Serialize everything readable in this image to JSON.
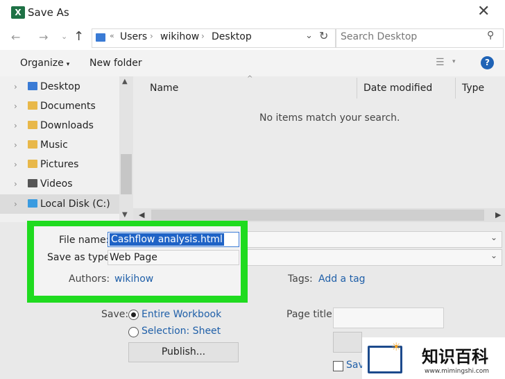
{
  "window": {
    "title": "Save As",
    "app_icon": "X"
  },
  "nav": {
    "path": [
      "Users",
      "wikihow",
      "Desktop"
    ],
    "path_overflow": "«",
    "search_placeholder": "Search Desktop"
  },
  "toolbar": {
    "organize": "Organize",
    "new_folder": "New folder",
    "help": "?"
  },
  "sidebar": {
    "items": [
      {
        "label": "Desktop"
      },
      {
        "label": "Documents"
      },
      {
        "label": "Downloads"
      },
      {
        "label": "Music"
      },
      {
        "label": "Pictures"
      },
      {
        "label": "Videos"
      },
      {
        "label": "Local Disk (C:)"
      }
    ]
  },
  "list": {
    "columns": [
      "Name",
      "Date modified",
      "Type"
    ],
    "empty_message": "No items match your search."
  },
  "form": {
    "file_name_label": "File name:",
    "file_name_value": "Cashflow analysis.html",
    "save_type_label": "Save as type:",
    "save_type_value": "Web Page",
    "authors_label": "Authors:",
    "authors_value": "wikihow",
    "tags_label": "Tags:",
    "tags_value": "Add a tag",
    "save_label": "Save:",
    "opt_workbook": "Entire Workbook",
    "opt_selection": "Selection: Sheet",
    "publish": "Publish...",
    "page_title_label": "Page title:",
    "save_check_partial": "Sav"
  },
  "watermark": {
    "cn": "知识百科",
    "url": "www.mimingshi.com"
  },
  "colors": {
    "highlight": "#1fdb1f",
    "excel": "#1e7145",
    "link": "#1f5fa8",
    "help": "#1f63b6"
  }
}
